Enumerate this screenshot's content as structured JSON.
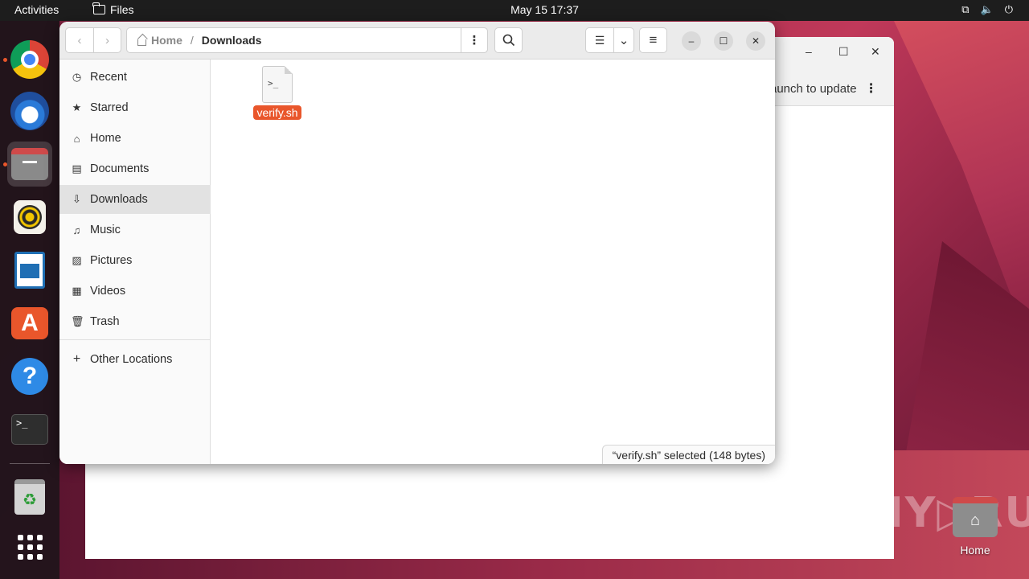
{
  "topbar": {
    "activities": "Activities",
    "app_name": "Files",
    "clock": "May 15  17:37"
  },
  "background_window": {
    "banner_text": "aunch to update",
    "minimize": "–",
    "maximize": "☐",
    "close": "✕"
  },
  "files_window": {
    "back": "‹",
    "forward": "›",
    "path": {
      "home": "Home",
      "separator": "/",
      "current": "Downloads"
    },
    "path_menu": "⋮",
    "search_icon": "search-icon",
    "view_list": "☰",
    "view_dropdown": "⌄",
    "main_menu": "≡",
    "minimize": "–",
    "maximize": "☐",
    "close": "✕",
    "sidebar": [
      {
        "label": "Recent",
        "icon": "◷"
      },
      {
        "label": "Starred",
        "icon": "★"
      },
      {
        "label": "Home",
        "icon": "⌂"
      },
      {
        "label": "Documents",
        "icon": "▤"
      },
      {
        "label": "Downloads",
        "icon": "⇩"
      },
      {
        "label": "Music",
        "icon": "♫"
      },
      {
        "label": "Pictures",
        "icon": "▨"
      },
      {
        "label": "Videos",
        "icon": "▦"
      },
      {
        "label": "Trash",
        "icon": "🗑"
      }
    ],
    "other_locations": {
      "label": "Other Locations",
      "icon": "+"
    },
    "files": [
      {
        "name": "verify.sh",
        "icon_text": ">_"
      }
    ],
    "status": "“verify.sh” selected  (148 bytes)"
  },
  "desktop": {
    "home_label": "Home",
    "watermark": "ANY▷RUN"
  },
  "dock": {
    "terminal_prompt": ">_"
  },
  "colors": {
    "accent": "#e9562b",
    "topbar": "#1d1d1d",
    "selected_row": "#e2e2e2"
  }
}
